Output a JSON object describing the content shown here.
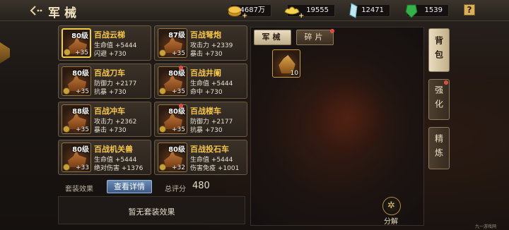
{
  "header": {
    "title": "军械",
    "back_icon": "back-arrow-icon"
  },
  "resources": [
    {
      "name": "gold",
      "icon": "gold-coins-icon",
      "value": "4687万",
      "color": "#f2c24b"
    },
    {
      "name": "silver",
      "icon": "silver-ingot-icon",
      "value": "19555",
      "color": "#f4d34e"
    },
    {
      "name": "crystal",
      "icon": "crystal-icon",
      "value": "12471",
      "color": "#bfe8f0"
    },
    {
      "name": "jade",
      "icon": "jade-icon",
      "value": "1539",
      "color": "#35b04a"
    }
  ],
  "help_label": "?",
  "items": [
    {
      "level": "80级",
      "name": "百战云梯",
      "stat1": "生命值 +5444",
      "stat2": "闪避 +730",
      "plus": "+35"
    },
    {
      "level": "87级",
      "name": "百战弩炮",
      "stat1": "攻击力 +2339",
      "stat2": "暴击 +730",
      "plus": "+35"
    },
    {
      "level": "80级",
      "name": "百战刀车",
      "stat1": "防御力 +2177",
      "stat2": "抗暴 +730",
      "plus": "+35"
    },
    {
      "level": "80级",
      "name": "百战井阑",
      "stat1": "生命值 +5444",
      "stat2": "命中 +730",
      "plus": "+35"
    },
    {
      "level": "88级",
      "name": "百战冲车",
      "stat1": "攻击力 +2362",
      "stat2": "暴击 +730",
      "plus": "+35"
    },
    {
      "level": "80级",
      "name": "百战楼车",
      "stat1": "防御力 +2177",
      "stat2": "抗暴 +730",
      "plus": "+35"
    },
    {
      "level": "80级",
      "name": "百战机关兽",
      "stat1": "生命值 +5444",
      "stat2": "绝对伤害 +1376",
      "plus": "+33"
    },
    {
      "level": "80级",
      "name": "百战投石车",
      "stat1": "生命值 +5444",
      "stat2": "伤害免疫 +1001",
      "plus": "+32"
    }
  ],
  "set_effect_label": "套装效果",
  "view_detail_label": "查看详情",
  "total_score_label": "总评分",
  "total_score_value": "480",
  "no_set_text": "暂无套装效果",
  "tabs": {
    "armory": "军械",
    "fragments": "碎片"
  },
  "inventory": [
    {
      "count": "10"
    }
  ],
  "decompose_label": "分解",
  "side_tabs": {
    "bag": "背包",
    "enhance": "强化",
    "refine": "精炼"
  },
  "watermark": "九一游戏网"
}
